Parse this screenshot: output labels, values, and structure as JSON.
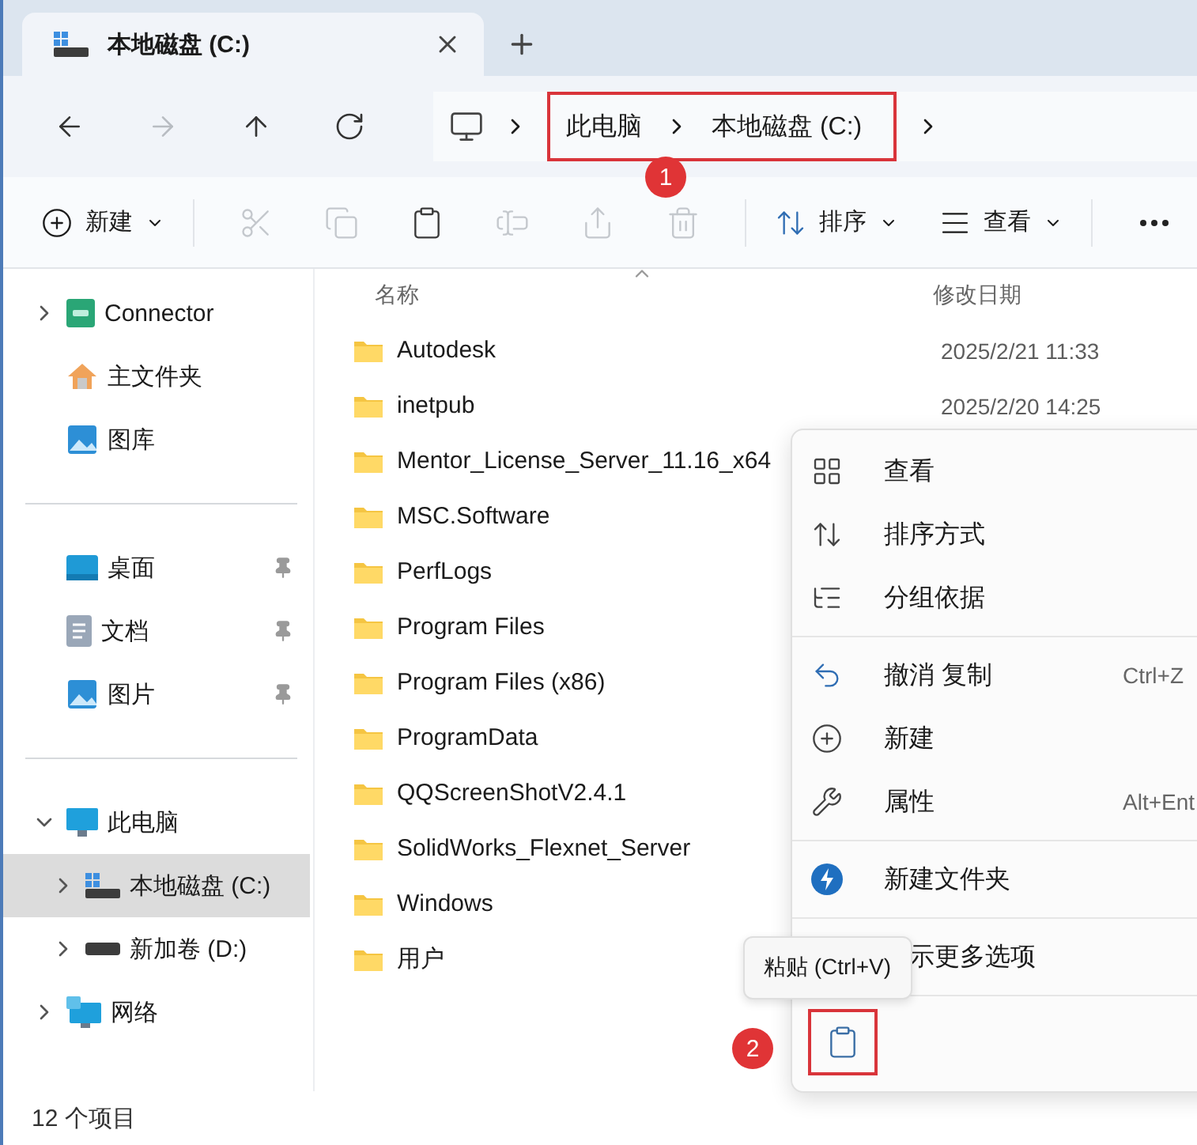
{
  "tab": {
    "title": "本地磁盘 (C:)"
  },
  "nav": [
    {
      "disabled": false
    },
    {
      "disabled": true
    },
    {
      "disabled": false
    },
    {
      "disabled": false
    }
  ],
  "breadcrumb": [
    "此电脑",
    "本地磁盘 (C:)"
  ],
  "toolbar": {
    "new": {
      "label": "新建"
    },
    "actions": [
      {
        "disabled": true
      },
      {
        "disabled": true
      },
      {
        "disabled": false
      },
      {
        "disabled": true
      },
      {
        "disabled": true
      },
      {
        "disabled": true
      }
    ],
    "sort": {
      "label": "排序"
    },
    "view": {
      "label": "查看"
    }
  },
  "sidebar": {
    "groups": [
      [
        {
          "label": "Connector",
          "kind": "app",
          "expanded": false
        },
        {
          "label": "主文件夹",
          "kind": "home"
        },
        {
          "label": "图库",
          "kind": "gallery"
        }
      ],
      [
        {
          "label": "桌面",
          "kind": "desktop",
          "pinned": true
        },
        {
          "label": "文档",
          "kind": "docs",
          "pinned": true
        },
        {
          "label": "图片",
          "kind": "pictures",
          "pinned": true
        }
      ],
      [
        {
          "label": "此电脑",
          "kind": "pc",
          "expanded": true,
          "children": [
            {
              "label": "本地磁盘 (C:)",
              "kind": "sysdrive",
              "expanded": false,
              "selected": true
            },
            {
              "label": "新加卷 (D:)",
              "kind": "drive",
              "expanded": false,
              "selected": false
            }
          ]
        },
        {
          "label": "网络",
          "kind": "network",
          "expanded": false
        }
      ]
    ]
  },
  "table": {
    "columns": [
      "名称",
      "修改日期"
    ],
    "rows": [
      {
        "name": "Autodesk",
        "date": "2025/2/21 11:33"
      },
      {
        "name": "inetpub",
        "date": "2025/2/20 14:25"
      },
      {
        "name": "Mentor_License_Server_11.16_x64"
      },
      {
        "name": "MSC.Software"
      },
      {
        "name": "PerfLogs"
      },
      {
        "name": "Program Files"
      },
      {
        "name": "Program Files (x86)"
      },
      {
        "name": "ProgramData"
      },
      {
        "name": "QQScreenShotV2.4.1"
      },
      {
        "name": "SolidWorks_Flexnet_Server"
      },
      {
        "name": "Windows"
      },
      {
        "name": "用户"
      }
    ]
  },
  "status_bar": "12 个项目",
  "context_menu": {
    "groups": [
      [
        {
          "label": "查看"
        },
        {
          "label": "排序方式"
        },
        {
          "label": "分组依据"
        }
      ],
      [
        {
          "label": "撤消 复制",
          "shortcut": "Ctrl+Z"
        },
        {
          "label": "新建"
        },
        {
          "label": "属性",
          "shortcut": "Alt+Ent"
        }
      ],
      [
        {
          "label": "新建文件夹"
        }
      ],
      [
        {
          "label": "示更多选项"
        }
      ]
    ]
  },
  "tooltip": "粘贴 (Ctrl+V)",
  "annotations": [
    "1",
    "2"
  ]
}
